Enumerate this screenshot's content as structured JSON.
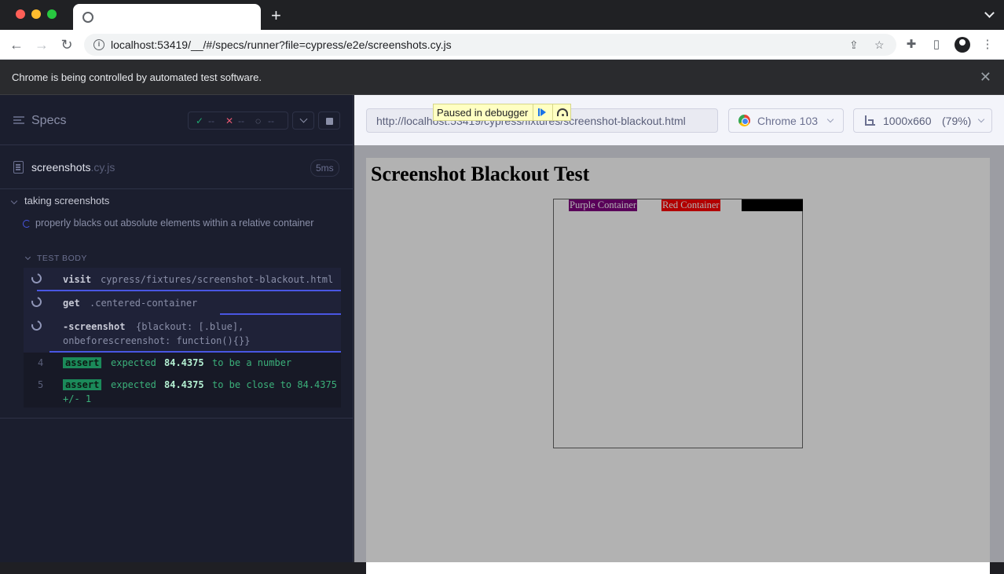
{
  "browser": {
    "new_tab_label": "+",
    "url": "localhost:53419/__/#/specs/runner?file=cypress/e2e/screenshots.cy.js",
    "automation_banner": "Chrome is being controlled by automated test software.",
    "banner_close": "✕"
  },
  "reporter": {
    "specs_label": "Specs",
    "stats": {
      "passed": "--",
      "failed": "--",
      "pending": "--"
    },
    "spec_file": {
      "name": "screenshots",
      "ext": ".cy.js",
      "duration": "5ms"
    },
    "suite_title": "taking screenshots",
    "test_title": "properly blacks out absolute elements within a relative container",
    "test_body_label": "TEST BODY",
    "commands": [
      {
        "name": "visit",
        "message": "cypress/fixtures/screenshot-blackout.html",
        "state": "pending"
      },
      {
        "name": "get",
        "message": ".centered-container",
        "state": "pending"
      },
      {
        "name": "-screenshot",
        "message": "{blackout: [.blue],",
        "message2": "onbeforescreenshot: function(){}}",
        "state": "pending"
      },
      {
        "number": "4",
        "name": "assert",
        "message": "expected",
        "value": "84.4375",
        "message_end": "to be a number",
        "state": "passed"
      },
      {
        "number": "5",
        "name": "assert",
        "message": "expected",
        "value": "84.4375",
        "message_end": "to be close to 84.4375",
        "message2": "+/- 1",
        "state": "passed"
      }
    ]
  },
  "aut": {
    "url": "http://localhost:53419/cypress/fixtures/screenshot-blackout.html",
    "browser": "Chrome 103",
    "viewport": "1000x660",
    "scale": "(79%)",
    "paused_label": "Paused in debugger",
    "page_title": "Screenshot Blackout Test",
    "purple_label": "Purple Container",
    "red_label": "Red Container"
  },
  "colors": {
    "reporter_bg": "#1b1e2e",
    "accent": "#4956e3",
    "pass": "#1b8a5a",
    "fail": "#e45770"
  }
}
